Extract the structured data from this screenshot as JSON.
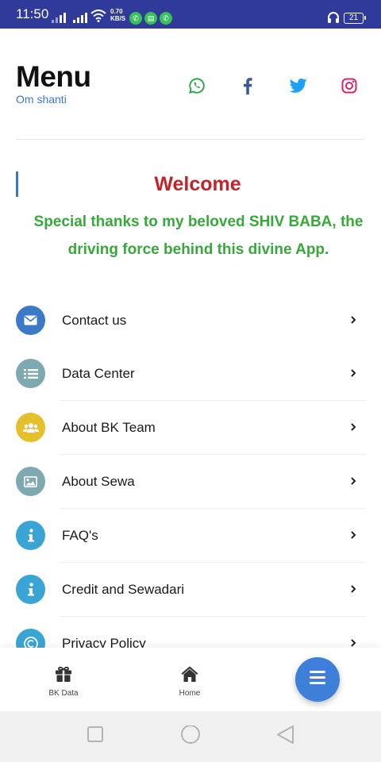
{
  "status_bar": {
    "time": "11:50",
    "net_speed_value": "0.70",
    "net_speed_unit": "KB/S",
    "battery": "21",
    "bg_color": "#2f3a9a"
  },
  "header": {
    "title": "Menu",
    "subtitle": "Om shanti",
    "social": [
      {
        "icon": "whatsapp-icon",
        "color": "#25a244"
      },
      {
        "icon": "facebook-icon",
        "color": "#3b5998"
      },
      {
        "icon": "twitter-icon",
        "color": "#1da1f2"
      },
      {
        "icon": "instagram-icon",
        "color": "#d6246e"
      }
    ]
  },
  "welcome": {
    "title": "Welcome",
    "message": "Special thanks to my beloved SHIV BABA, the driving force behind this divine App.",
    "title_color": "#c4232a",
    "message_color": "#37a93a"
  },
  "menu": {
    "items": [
      {
        "label": "Contact us",
        "icon": "envelope-icon",
        "color": "#3c79c8"
      },
      {
        "label": "Data Center",
        "icon": "list-icon",
        "color": "#7fa9b0"
      },
      {
        "label": "About BK Team",
        "icon": "users-icon",
        "color": "#e5c02d"
      },
      {
        "label": "About Sewa",
        "icon": "image-icon",
        "color": "#7fa9b0"
      },
      {
        "label": "FAQ's",
        "icon": "info-icon",
        "color": "#3aa5d4"
      },
      {
        "label": "Credit and Sewadari",
        "icon": "info-icon",
        "color": "#3aa5d4"
      },
      {
        "label": "Privacy Policy",
        "icon": "copyright-icon",
        "color": "#3aa5d4"
      }
    ]
  },
  "bottom_nav": {
    "bk_data_label": "BK Data",
    "home_label": "Home",
    "fab_color": "#3d7fd9"
  }
}
